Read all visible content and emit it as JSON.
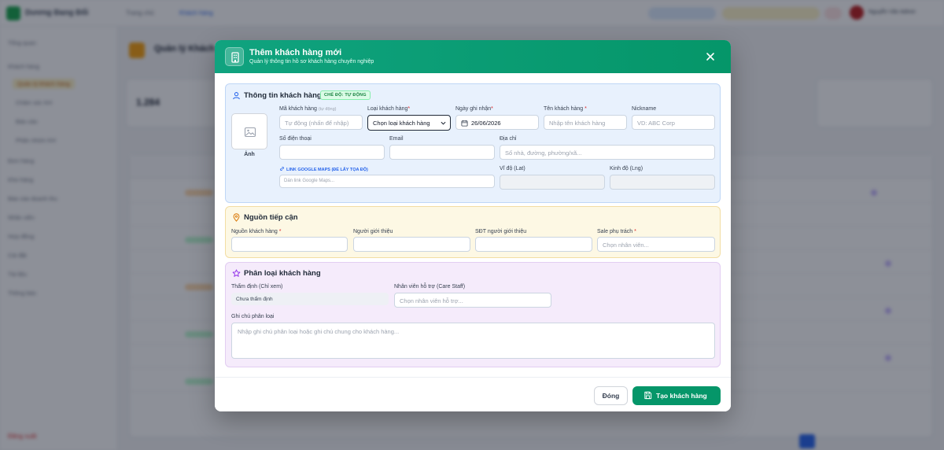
{
  "background": {
    "brand": "Dương Đang Đổi",
    "crumb": "Trang chủ",
    "crumb_current": "Khách hàng",
    "user_name": "Nguyễn Văn Admin",
    "sidebar_items": [
      "Tổng quan",
      "Khách hàng",
      "Quản lý khách hàng",
      "Chăm sóc KH",
      "Báo cáo",
      "Phân nhóm KH",
      "Đơn hàng",
      "Kho hàng",
      "Báo cáo doanh thu",
      "Nhân viên",
      "Hợp đồng",
      "Cài đặt",
      "Tài liệu",
      "Thông báo"
    ],
    "logout": "Đăng xuất",
    "page_title": "Quản lý Khách hàng",
    "card_value": "1.284"
  },
  "modal": {
    "title": "Thêm khách hàng mới",
    "subtitle": "Quản lý thông tin hồ sơ khách hàng chuyên nghiệp",
    "section_customer": {
      "title": "Thông tin khách hàng",
      "badge": "CHẾ ĐỘ: TỰ ĐỘNG",
      "photo_label": "Ảnh",
      "code_label": "Mã khách hàng",
      "code_hint": "(tự động)",
      "code_placeholder": "Tự động (nhấn để nhập)",
      "type_label": "Loại khách hàng",
      "type_value": "Chọn loại khách hàng",
      "date_label": "Ngày ghi nhận",
      "date_value": "26/06/2026",
      "name_label": "Tên khách hàng",
      "name_placeholder": "Nhập tên khách hàng",
      "nickname_label": "Nickname",
      "nickname_placeholder": "VD: ABC Corp",
      "phone_label": "Số điện thoại",
      "email_label": "Email",
      "address_label": "Địa chỉ",
      "address_placeholder": "Số nhà, đường, phường/xã...",
      "maps_link": "LINK GOOGLE MAPS (ĐỂ LẤY TỌA ĐỘ)",
      "maps_placeholder": "Dán link Google Maps...",
      "lat_label": "Vĩ độ (Lat)",
      "lng_label": "Kinh độ (Lng)"
    },
    "section_source": {
      "title": "Nguồn tiếp cận",
      "source_label": "Nguồn khách hàng",
      "referrer_label": "Người giới thiệu",
      "referrer_phone_label": "SĐT người giới thiệu",
      "sale_label": "Sale phụ trách",
      "sale_placeholder": "Chọn nhân viên..."
    },
    "section_classify": {
      "title": "Phân loại khách hàng",
      "review_label": "Thẩm định (Chỉ xem)",
      "review_value": "Chưa thẩm định",
      "care_label": "Nhân viên hỗ trợ (Care Staff)",
      "care_placeholder": "Chọn nhân viên hỗ trợ...",
      "note_label": "Ghi chú phân loại",
      "note_placeholder": "Nhập ghi chú phân loại hoặc ghi chú chung cho khách hàng..."
    },
    "footer": {
      "close_label": "Đóng",
      "create_label": "Tạo khách hàng"
    }
  },
  "colors": {
    "header": "#059669",
    "primary_button": "#059669",
    "section_customer_bg": "#e8f1fd",
    "section_source_bg": "#fdf8e4",
    "section_classify_bg": "#f5ebfb",
    "required": "#dc2626"
  }
}
